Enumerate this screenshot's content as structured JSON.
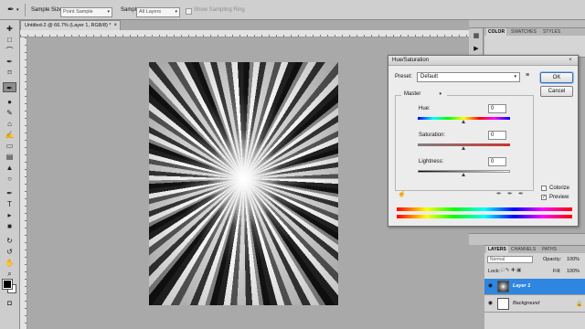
{
  "options_bar": {
    "sample_size_label": "Sample Size:",
    "sample_size_value": "Point Sample",
    "sample_label": "Sample:",
    "sample_value": "All Layers",
    "show_sampling_ring": "Show Sampling Ring"
  },
  "document": {
    "tab_title": "Untitled-2 @ 66.7% (Layer 1, RGB/8) *"
  },
  "color_panel": {
    "tabs": [
      "COLOR",
      "SWATCHES",
      "STYLES"
    ]
  },
  "dialog": {
    "title": "Hue/Saturation",
    "preset_label": "Preset:",
    "preset_value": "Default",
    "ok_label": "OK",
    "cancel_label": "Cancel",
    "channel_value": "Master",
    "hue_label": "Hue:",
    "hue_value": "0",
    "saturation_label": "Saturation:",
    "saturation_value": "0",
    "lightness_label": "Lightness:",
    "lightness_value": "0",
    "colorize_label": "Colorize",
    "preview_label": "Preview",
    "preview_checked": true,
    "colorize_checked": false
  },
  "layers_panel": {
    "tabs": [
      "LAYERS",
      "CHANNELS",
      "PATHS"
    ],
    "blend_mode": "Normal",
    "opacity_label": "Opacity:",
    "opacity_value": "100%",
    "lock_label": "Lock:",
    "fill_label": "Fill:",
    "fill_value": "100%",
    "layers": [
      {
        "name": "Layer 1",
        "selected": true
      },
      {
        "name": "Background",
        "selected": false
      }
    ]
  },
  "colors": {
    "layer_selected": "#2f86e0",
    "foreground": "#000000",
    "background": "#ffffff"
  }
}
